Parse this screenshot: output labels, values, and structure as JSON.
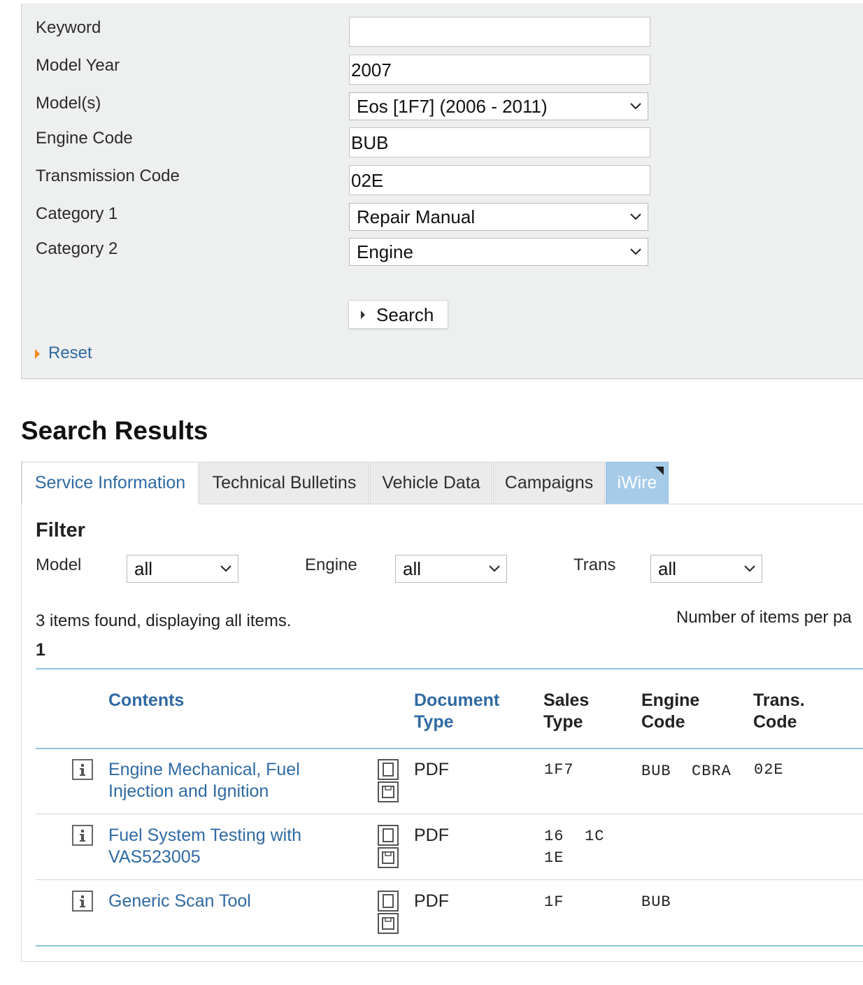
{
  "form": {
    "labels": {
      "keyword": "Keyword",
      "model_year": "Model Year",
      "models": "Model(s)",
      "engine_code": "Engine Code",
      "transmission_code": "Transmission Code",
      "category1": "Category 1",
      "category2": "Category 2"
    },
    "values": {
      "keyword": "",
      "model_year": "2007",
      "models": "Eos [1F7] (2006 - 2011)",
      "engine_code": "BUB",
      "transmission_code": "02E",
      "category1": "Repair Manual",
      "category2": "Engine"
    },
    "search_label": "Search",
    "reset_label": "Reset"
  },
  "results": {
    "title": "Search Results",
    "tabs": [
      {
        "label": "Service Information",
        "active": true
      },
      {
        "label": "Technical Bulletins",
        "active": false
      },
      {
        "label": "Vehicle Data",
        "active": false
      },
      {
        "label": "Campaigns",
        "active": false
      },
      {
        "label": "iWire",
        "active": false
      }
    ],
    "filter": {
      "title": "Filter",
      "model_label": "Model",
      "model_value": "all",
      "engine_label": "Engine",
      "engine_value": "all",
      "trans_label": "Trans",
      "trans_value": "all"
    },
    "items_found": "3 items found, displaying all items.",
    "items_per_page": "Number of items per pa",
    "page": "1",
    "columns": {
      "contents": "Contents",
      "document_type_1": "Document",
      "document_type_2": "Type",
      "sales_type_1": "Sales",
      "sales_type_2": "Type",
      "engine_code_1": "Engine",
      "engine_code_2": "Code",
      "trans_code_1": "Trans.",
      "trans_code_2": "Code"
    },
    "rows": [
      {
        "title_1": "Engine Mechanical, Fuel",
        "title_2": "Injection and Ignition",
        "doc_type": "PDF",
        "sales_1": "1F7",
        "sales_2": "",
        "engine_1": "BUB",
        "engine_2": "CBRA",
        "trans": "02E"
      },
      {
        "title_1": "Fuel System Testing with",
        "title_2": "VAS523005",
        "doc_type": "PDF",
        "sales_1": "16",
        "sales_1b": "1C",
        "sales_2": "1E",
        "engine_1": "",
        "engine_2": "",
        "trans": ""
      },
      {
        "title_1": "Generic Scan Tool",
        "title_2": "",
        "doc_type": "PDF",
        "sales_1": "1F",
        "sales_2": "",
        "engine_1": "BUB",
        "engine_2": "",
        "trans": ""
      }
    ]
  },
  "colors": {
    "link": "#2f6aa3",
    "panel": "#eeefef",
    "accent_line": "#8cc3df",
    "reset_arrow": "#f08a1c",
    "iwire_tab": "#a6cbe9"
  }
}
